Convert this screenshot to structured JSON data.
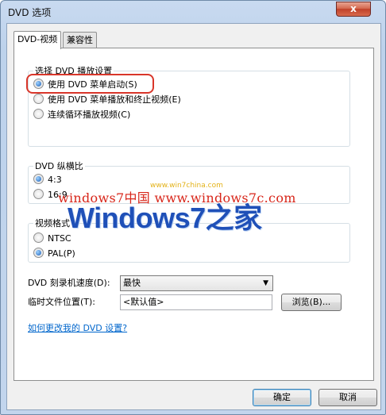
{
  "window": {
    "title": "DVD 选项",
    "close_glyph": "x"
  },
  "tabs": [
    {
      "label": "DVD-视频",
      "active": true
    },
    {
      "label": "兼容性",
      "active": false
    }
  ],
  "playback_group": {
    "label": "选择 DVD 播放设置",
    "options": [
      {
        "label": "使用 DVD 菜单启动(S)",
        "checked": true
      },
      {
        "label": "使用 DVD 菜单播放和终止视频(E)",
        "checked": false
      },
      {
        "label": "连续循环播放视频(C)",
        "checked": false
      }
    ]
  },
  "aspect_group": {
    "label": "DVD 纵横比",
    "options": [
      {
        "label": "4:3",
        "checked": true
      },
      {
        "label": "16:9",
        "checked": false
      }
    ]
  },
  "format_group": {
    "label": "视频格式",
    "options": [
      {
        "label": "NTSC",
        "checked": false
      },
      {
        "label": "PAL(P)",
        "checked": true
      }
    ]
  },
  "burner_speed": {
    "label": "DVD 刻录机速度(D):",
    "value": "最快"
  },
  "temp_location": {
    "label": "临时文件位置(T):",
    "value": "<默认值>",
    "browse_label": "浏览(B)..."
  },
  "help_link": "如何更改我的 DVD 设置?",
  "buttons": {
    "ok": "确定",
    "cancel": "取消"
  },
  "watermark": {
    "line1": "windows7中国 www.windows7c.com",
    "site": "www.win7china.com",
    "logo": "Windows7之家"
  },
  "colors": {
    "highlight_ring": "#d9362a",
    "link": "#0066cc",
    "watermark_red": "#d8261a",
    "watermark_blue": "#1f50b8"
  }
}
